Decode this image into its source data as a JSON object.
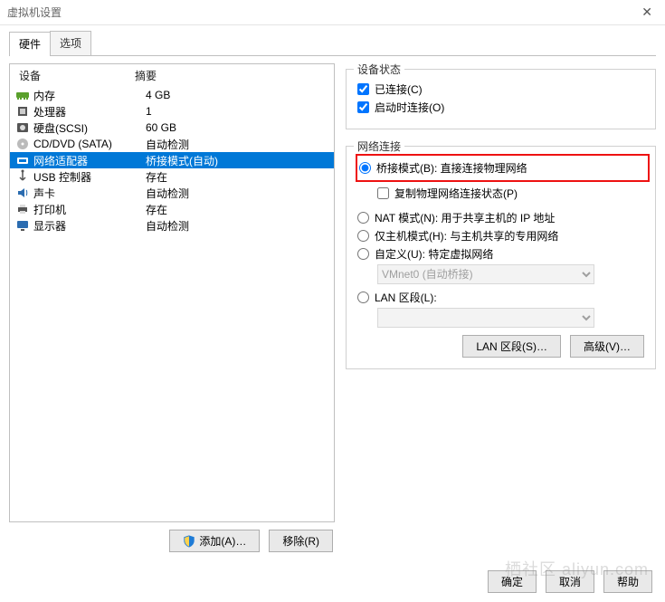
{
  "title": "虚拟机设置",
  "tabs": {
    "hardware": "硬件",
    "options": "选项"
  },
  "device_headers": {
    "device": "设备",
    "summary": "摘要"
  },
  "devices": [
    {
      "icon": "memory",
      "name": "内存",
      "summary": "4 GB",
      "selected": false
    },
    {
      "icon": "cpu",
      "name": "处理器",
      "summary": "1",
      "selected": false
    },
    {
      "icon": "disk",
      "name": "硬盘(SCSI)",
      "summary": "60 GB",
      "selected": false
    },
    {
      "icon": "cd",
      "name": "CD/DVD (SATA)",
      "summary": "自动检测",
      "selected": false
    },
    {
      "icon": "net",
      "name": "网络适配器",
      "summary": "桥接模式(自动)",
      "selected": true
    },
    {
      "icon": "usb",
      "name": "USB 控制器",
      "summary": "存在",
      "selected": false
    },
    {
      "icon": "sound",
      "name": "声卡",
      "summary": "自动检测",
      "selected": false
    },
    {
      "icon": "printer",
      "name": "打印机",
      "summary": "存在",
      "selected": false
    },
    {
      "icon": "display",
      "name": "显示器",
      "summary": "自动检测",
      "selected": false
    }
  ],
  "left_buttons": {
    "add": "添加(A)…",
    "remove": "移除(R)"
  },
  "device_state": {
    "legend": "设备状态",
    "connected": "已连接(C)",
    "connect_at_power_on": "启动时连接(O)"
  },
  "network": {
    "legend": "网络连接",
    "bridged": "桥接模式(B): 直接连接物理网络",
    "replicate": "复制物理网络连接状态(P)",
    "nat": "NAT 模式(N): 用于共享主机的 IP 地址",
    "hostonly": "仅主机模式(H): 与主机共享的专用网络",
    "custom": "自定义(U): 特定虚拟网络",
    "custom_select_value": "VMnet0 (自动桥接)",
    "lan_segment": "LAN 区段(L):",
    "lan_segment_select_value": "",
    "lan_segments_btn": "LAN 区段(S)…",
    "advanced_btn": "高级(V)…"
  },
  "footer": {
    "ok": "确定",
    "cancel": "取消",
    "help": "帮助"
  },
  "watermark": "栖社区 aliyun.com"
}
